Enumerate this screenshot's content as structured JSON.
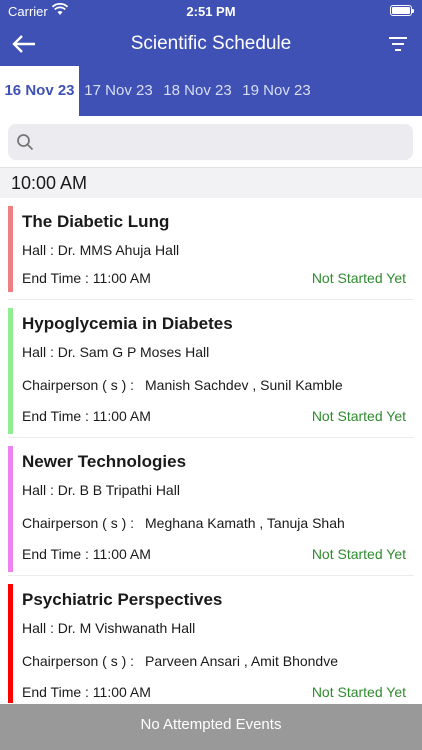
{
  "status_bar": {
    "carrier": "Carrier",
    "time": "2:51 PM"
  },
  "header": {
    "title": "Scientific Schedule"
  },
  "tabs": [
    {
      "label": "16 Nov 23",
      "active": true
    },
    {
      "label": "17 Nov 23",
      "active": false
    },
    {
      "label": "18 Nov 23",
      "active": false
    },
    {
      "label": "19 Nov 23",
      "active": false
    }
  ],
  "search": {
    "placeholder": "",
    "value": ""
  },
  "section": {
    "time": "10:00 AM"
  },
  "sessions": [
    {
      "title": "The Diabetic Lung",
      "hall": "Hall : Dr. MMS Ahuja Hall",
      "chair_label": "",
      "chairperson": "",
      "end_time": "End Time : 11:00 AM",
      "status": "Not Started Yet",
      "color": "#f08080"
    },
    {
      "title": "Hypoglycemia in Diabetes",
      "hall": "Hall : Dr. Sam G P Moses Hall",
      "chair_label": "Chairperson ( s ) :",
      "chairperson": "Manish Sachdev , Sunil Kamble",
      "end_time": "End Time : 11:00 AM",
      "status": "Not Started Yet",
      "color": "#90ee90"
    },
    {
      "title": "Newer Technologies",
      "hall": "Hall : Dr. B B Tripathi Hall",
      "chair_label": "Chairperson ( s ) :",
      "chairperson": "Meghana Kamath , Tanuja Shah",
      "end_time": "End Time : 11:00 AM",
      "status": "Not Started Yet",
      "color": "#ee82ee"
    },
    {
      "title": "Psychiatric Perspectives",
      "hall": "Hall : Dr. M Vishwanath Hall",
      "chair_label": "Chairperson ( s ) :",
      "chairperson": "Parveen Ansari , Amit Bhondve",
      "end_time": "End Time : 11:00 AM",
      "status": "Not Started Yet",
      "color": "#ff0000"
    }
  ],
  "footer": {
    "label": "No Attempted Events"
  },
  "colors": {
    "primary": "#3f51b5",
    "status_green": "#2e8b2e",
    "footer_gray": "#999999"
  },
  "icons": {
    "back": "arrow-left-icon",
    "filter": "filter-icon",
    "search": "search-icon",
    "wifi": "wifi-icon",
    "battery": "battery-icon"
  }
}
